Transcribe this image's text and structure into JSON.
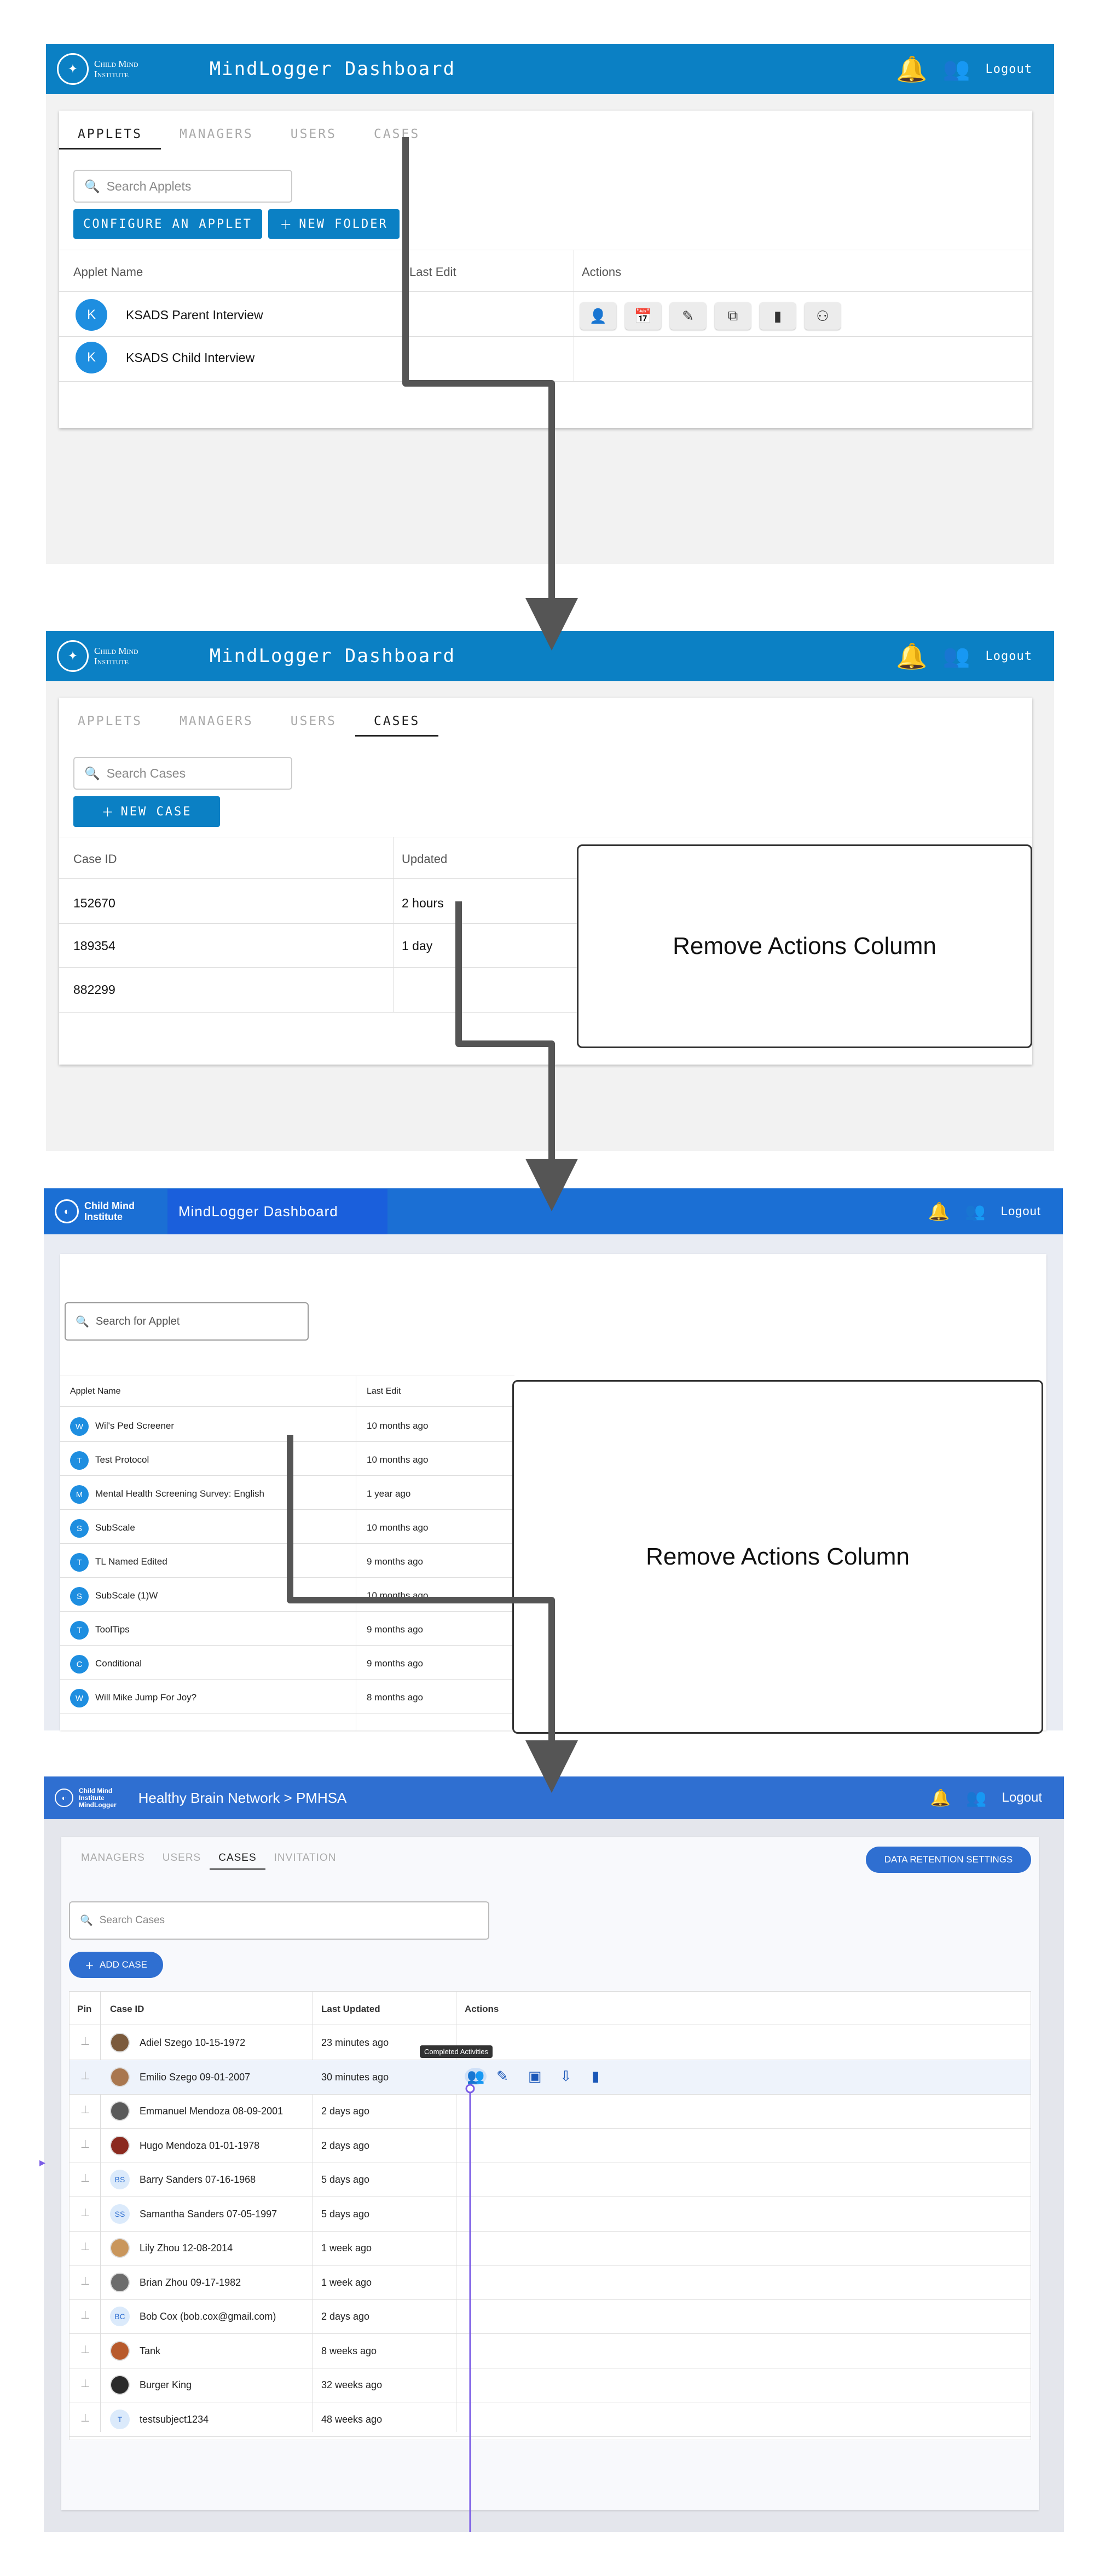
{
  "header": {
    "logo_line1": "Child Mind",
    "logo_line2": "Institute",
    "title": "MindLogger Dashboard",
    "logout": "Logout"
  },
  "panel1": {
    "tabs": [
      "APPLETS",
      "MANAGERS",
      "USERS",
      "CASES"
    ],
    "search_placeholder": "Search Applets",
    "configure_button": "CONFIGURE AN APPLET",
    "new_folder_button": "NEW FOLDER",
    "columns": [
      "Applet Name",
      "Last Edit",
      "Actions"
    ],
    "rows": [
      {
        "initial": "K",
        "name": "KSADS Parent Interview"
      },
      {
        "initial": "K",
        "name": "KSADS Child Interview"
      }
    ],
    "action_icons": [
      "person-icon",
      "calendar-icon",
      "edit-icon",
      "duplicate-icon",
      "delete-icon",
      "transfer-icon"
    ]
  },
  "panel2": {
    "tabs": [
      "APPLETS",
      "MANAGERS",
      "USERS",
      "CASES"
    ],
    "search_placeholder": "Search Cases",
    "new_case_button": "NEW CASE",
    "columns": [
      "Case ID",
      "Updated"
    ],
    "rows": [
      {
        "id": "152670",
        "updated": "2 hours"
      },
      {
        "id": "189354",
        "updated": "1 day"
      },
      {
        "id": "882299",
        "updated": ""
      }
    ],
    "note": "Remove Actions Column"
  },
  "panel3": {
    "logo_line1": "Child Mind",
    "logo_line2": "Institute",
    "title": "MindLogger Dashboard",
    "logout": "Logout",
    "search_placeholder": "Search for Applet",
    "columns": [
      "Applet Name",
      "Last Edit"
    ],
    "rows": [
      {
        "initial": "W",
        "name": "Wil's Ped Screener",
        "edit": "10 months ago"
      },
      {
        "initial": "T",
        "name": "Test Protocol",
        "edit": "10 months ago"
      },
      {
        "initial": "M",
        "name": "Mental Health Screening Survey: English",
        "edit": "1 year ago"
      },
      {
        "initial": "S",
        "name": "SubScale",
        "edit": "10 months ago"
      },
      {
        "initial": "T",
        "name": "TL Named Edited",
        "edit": "9 months ago"
      },
      {
        "initial": "S",
        "name": "SubScale (1)W",
        "edit": "10 months ago"
      },
      {
        "initial": "T",
        "name": "ToolTips",
        "edit": "9 months ago"
      },
      {
        "initial": "C",
        "name": "Conditional",
        "edit": "9 months ago"
      },
      {
        "initial": "W",
        "name": "Will Mike Jump For Joy?",
        "edit": "8 months ago"
      }
    ],
    "note": "Remove Actions Column"
  },
  "panel4": {
    "logo_line1": "Child Mind",
    "logo_line2": "Institute",
    "logo_line3": "MindLogger",
    "breadcrumb": "Healthy Brain Network > PMHSA",
    "logout": "Logout",
    "tabs": [
      "MANAGERS",
      "USERS",
      "CASES",
      "INVITATION"
    ],
    "retention_button": "DATA RETENTION SETTINGS",
    "search_placeholder": "Search Cases",
    "add_case_button": "ADD CASE",
    "columns": [
      "Pin",
      "Case ID",
      "Last Updated",
      "Actions"
    ],
    "tooltip": "Completed Activities",
    "rows": [
      {
        "avatar": "photo",
        "name": "Adiel Szego 10-15-1972",
        "updated": "23 minutes ago"
      },
      {
        "avatar": "photo",
        "name": "Emilio Szego 09-01-2007",
        "updated": "30 minutes ago"
      },
      {
        "avatar": "photo",
        "name": "Emmanuel Mendoza 08-09-2001",
        "updated": "2 days ago"
      },
      {
        "avatar": "photo",
        "name": "Hugo Mendoza 01-01-1978",
        "updated": "2 days ago"
      },
      {
        "avatar": "BS",
        "name": "Barry Sanders 07-16-1968",
        "updated": "5 days ago"
      },
      {
        "avatar": "SS",
        "name": "Samantha Sanders 07-05-1997",
        "updated": "5 days ago"
      },
      {
        "avatar": "photo",
        "name": "Lily Zhou 12-08-2014",
        "updated": "1 week ago"
      },
      {
        "avatar": "photo",
        "name": "Brian Zhou 09-17-1982",
        "updated": "1 week ago"
      },
      {
        "avatar": "BC",
        "name": "Bob Cox (bob.cox@gmail.com)",
        "updated": "2 days ago"
      },
      {
        "avatar": "photo",
        "name": "Tank",
        "updated": "8 weeks ago"
      },
      {
        "avatar": "photo",
        "name": "Burger King",
        "updated": "32 weeks ago"
      },
      {
        "avatar": "T",
        "name": "testsubject1234",
        "updated": "48 weeks ago"
      }
    ],
    "action_icons": [
      "completed-activities-icon",
      "edit-icon",
      "account-icon",
      "export-icon",
      "delete-icon"
    ]
  }
}
